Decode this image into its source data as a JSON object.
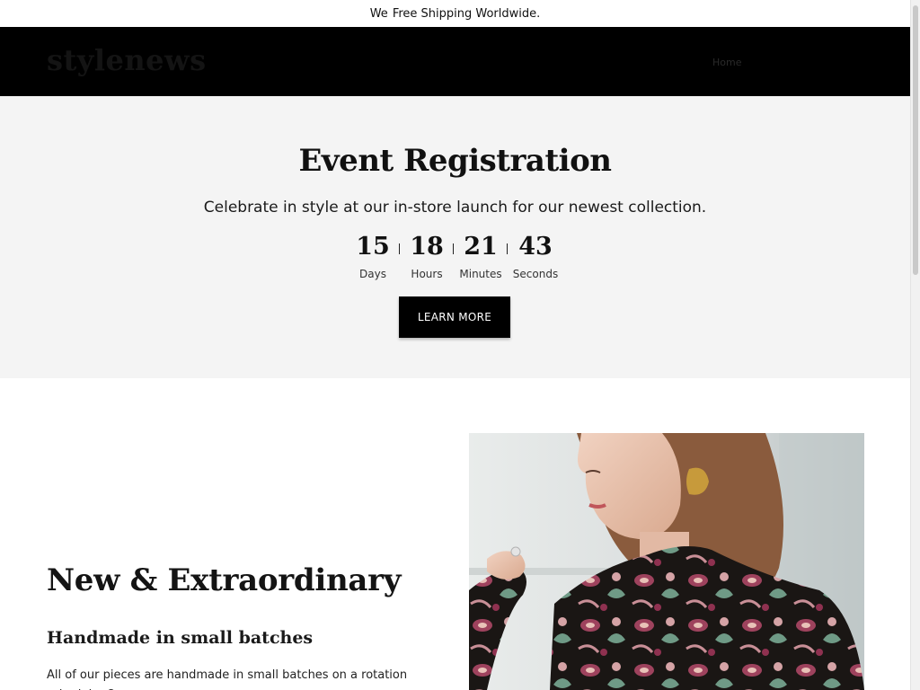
{
  "announcement": {
    "prefix": "We",
    "text": "Free Shipping Worldwide."
  },
  "header": {
    "logo": "stylenews",
    "nav_link": "Home"
  },
  "hero": {
    "title": "Event Registration",
    "subtitle": "Celebrate in style at our in-store launch for our newest collection.",
    "countdown": [
      {
        "value": "15",
        "label": "Days"
      },
      {
        "value": "18",
        "label": "Hours"
      },
      {
        "value": "21",
        "label": "Minutes"
      },
      {
        "value": "43",
        "label": "Seconds"
      }
    ],
    "cta_label": "LEARN MORE"
  },
  "feature": {
    "title": "New & Extraordinary",
    "subtitle": "Handmade in small batches",
    "body": "All of our pieces are handmade in small batches on a rotation schedule. Our",
    "image": {
      "alt": "Woman wearing floral paisley blouse with gold earring"
    }
  },
  "colors": {
    "header_bg": "#000000",
    "hero_bg": "#f4f4f4",
    "button_bg": "#000000",
    "button_text": "#ffffff"
  }
}
